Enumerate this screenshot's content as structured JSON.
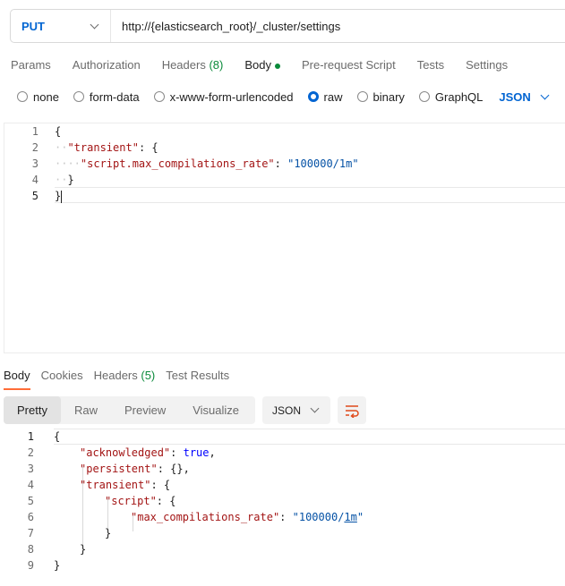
{
  "request": {
    "method": "PUT",
    "url": "http://{elasticsearch_root}/_cluster/settings"
  },
  "request_tabs": [
    {
      "label": "Params"
    },
    {
      "label": "Authorization"
    },
    {
      "label": "Headers",
      "count": "(8)"
    },
    {
      "label": "Body"
    },
    {
      "label": "Pre-request Script"
    },
    {
      "label": "Tests"
    },
    {
      "label": "Settings"
    }
  ],
  "body_types": [
    {
      "label": "none"
    },
    {
      "label": "form-data"
    },
    {
      "label": "x-www-form-urlencoded"
    },
    {
      "label": "raw"
    },
    {
      "label": "binary"
    },
    {
      "label": "GraphQL"
    }
  ],
  "body_language": "JSON",
  "request_editor": {
    "line_numbers": [
      "1",
      "2",
      "3",
      "4",
      "5"
    ],
    "open_brace": "{",
    "close_brace": "}",
    "key_transient": "\"transient\"",
    "key_rate": "\"script.max_compilations_rate\"",
    "value_rate": "\"100000/1m\""
  },
  "response_tabs": [
    {
      "label": "Body"
    },
    {
      "label": "Cookies"
    },
    {
      "label": "Headers",
      "count": "(5)"
    },
    {
      "label": "Test Results"
    }
  ],
  "view_modes": [
    "Pretty",
    "Raw",
    "Preview",
    "Visualize"
  ],
  "response_format": "JSON",
  "response_editor": {
    "line_numbers": [
      "1",
      "2",
      "3",
      "4",
      "5",
      "6",
      "7",
      "8",
      "9"
    ],
    "key_acknowledged": "\"acknowledged\"",
    "value_true": "true",
    "key_persistent": "\"persistent\"",
    "value_empty": "{}",
    "key_transient": "\"transient\"",
    "key_script": "\"script\"",
    "key_max": "\"max_compilations_rate\"",
    "value_rate_start": "\"100000/",
    "value_rate_unit": "1m",
    "value_rate_end": "\""
  },
  "colors": {
    "accent": "#0265d2",
    "tab_underline": "#ff6c37",
    "count_green": "#0a8a3a"
  }
}
